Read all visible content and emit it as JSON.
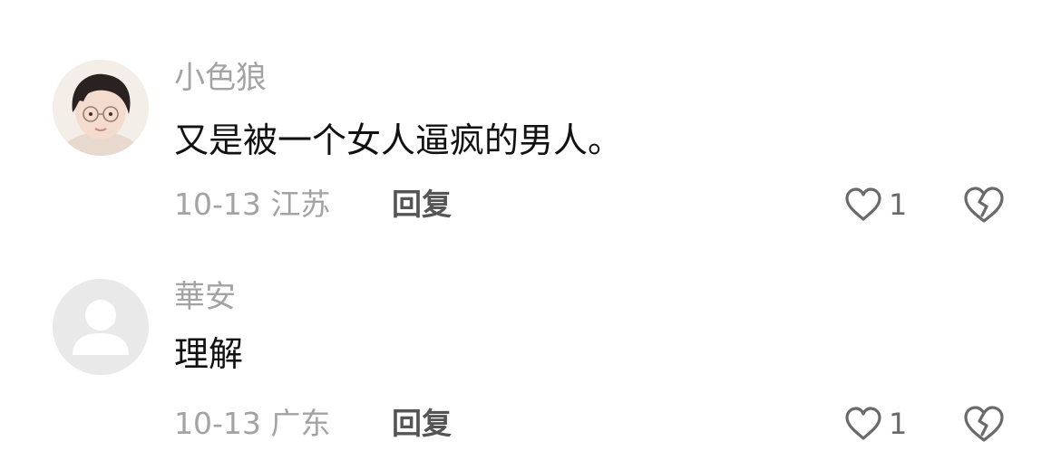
{
  "comments": [
    {
      "username": "小色狼",
      "text": "又是被一个女人逼疯的男人。",
      "date": "10-13",
      "location": "江苏",
      "reply_label": "回复",
      "like_count": "1",
      "avatar": "user-photo-avatar"
    },
    {
      "username": "華安",
      "text": "理解",
      "date": "10-13",
      "location": "广东",
      "reply_label": "回复",
      "like_count": "1",
      "avatar": "default-avatar"
    }
  ],
  "icons": {
    "like": "heart-outline-icon",
    "dislike": "broken-heart-icon"
  },
  "colors": {
    "username": "#a3a3a3",
    "text": "#111111",
    "meta": "#a3a3a3",
    "reply": "#555555",
    "icon": "#6a6a6a"
  }
}
